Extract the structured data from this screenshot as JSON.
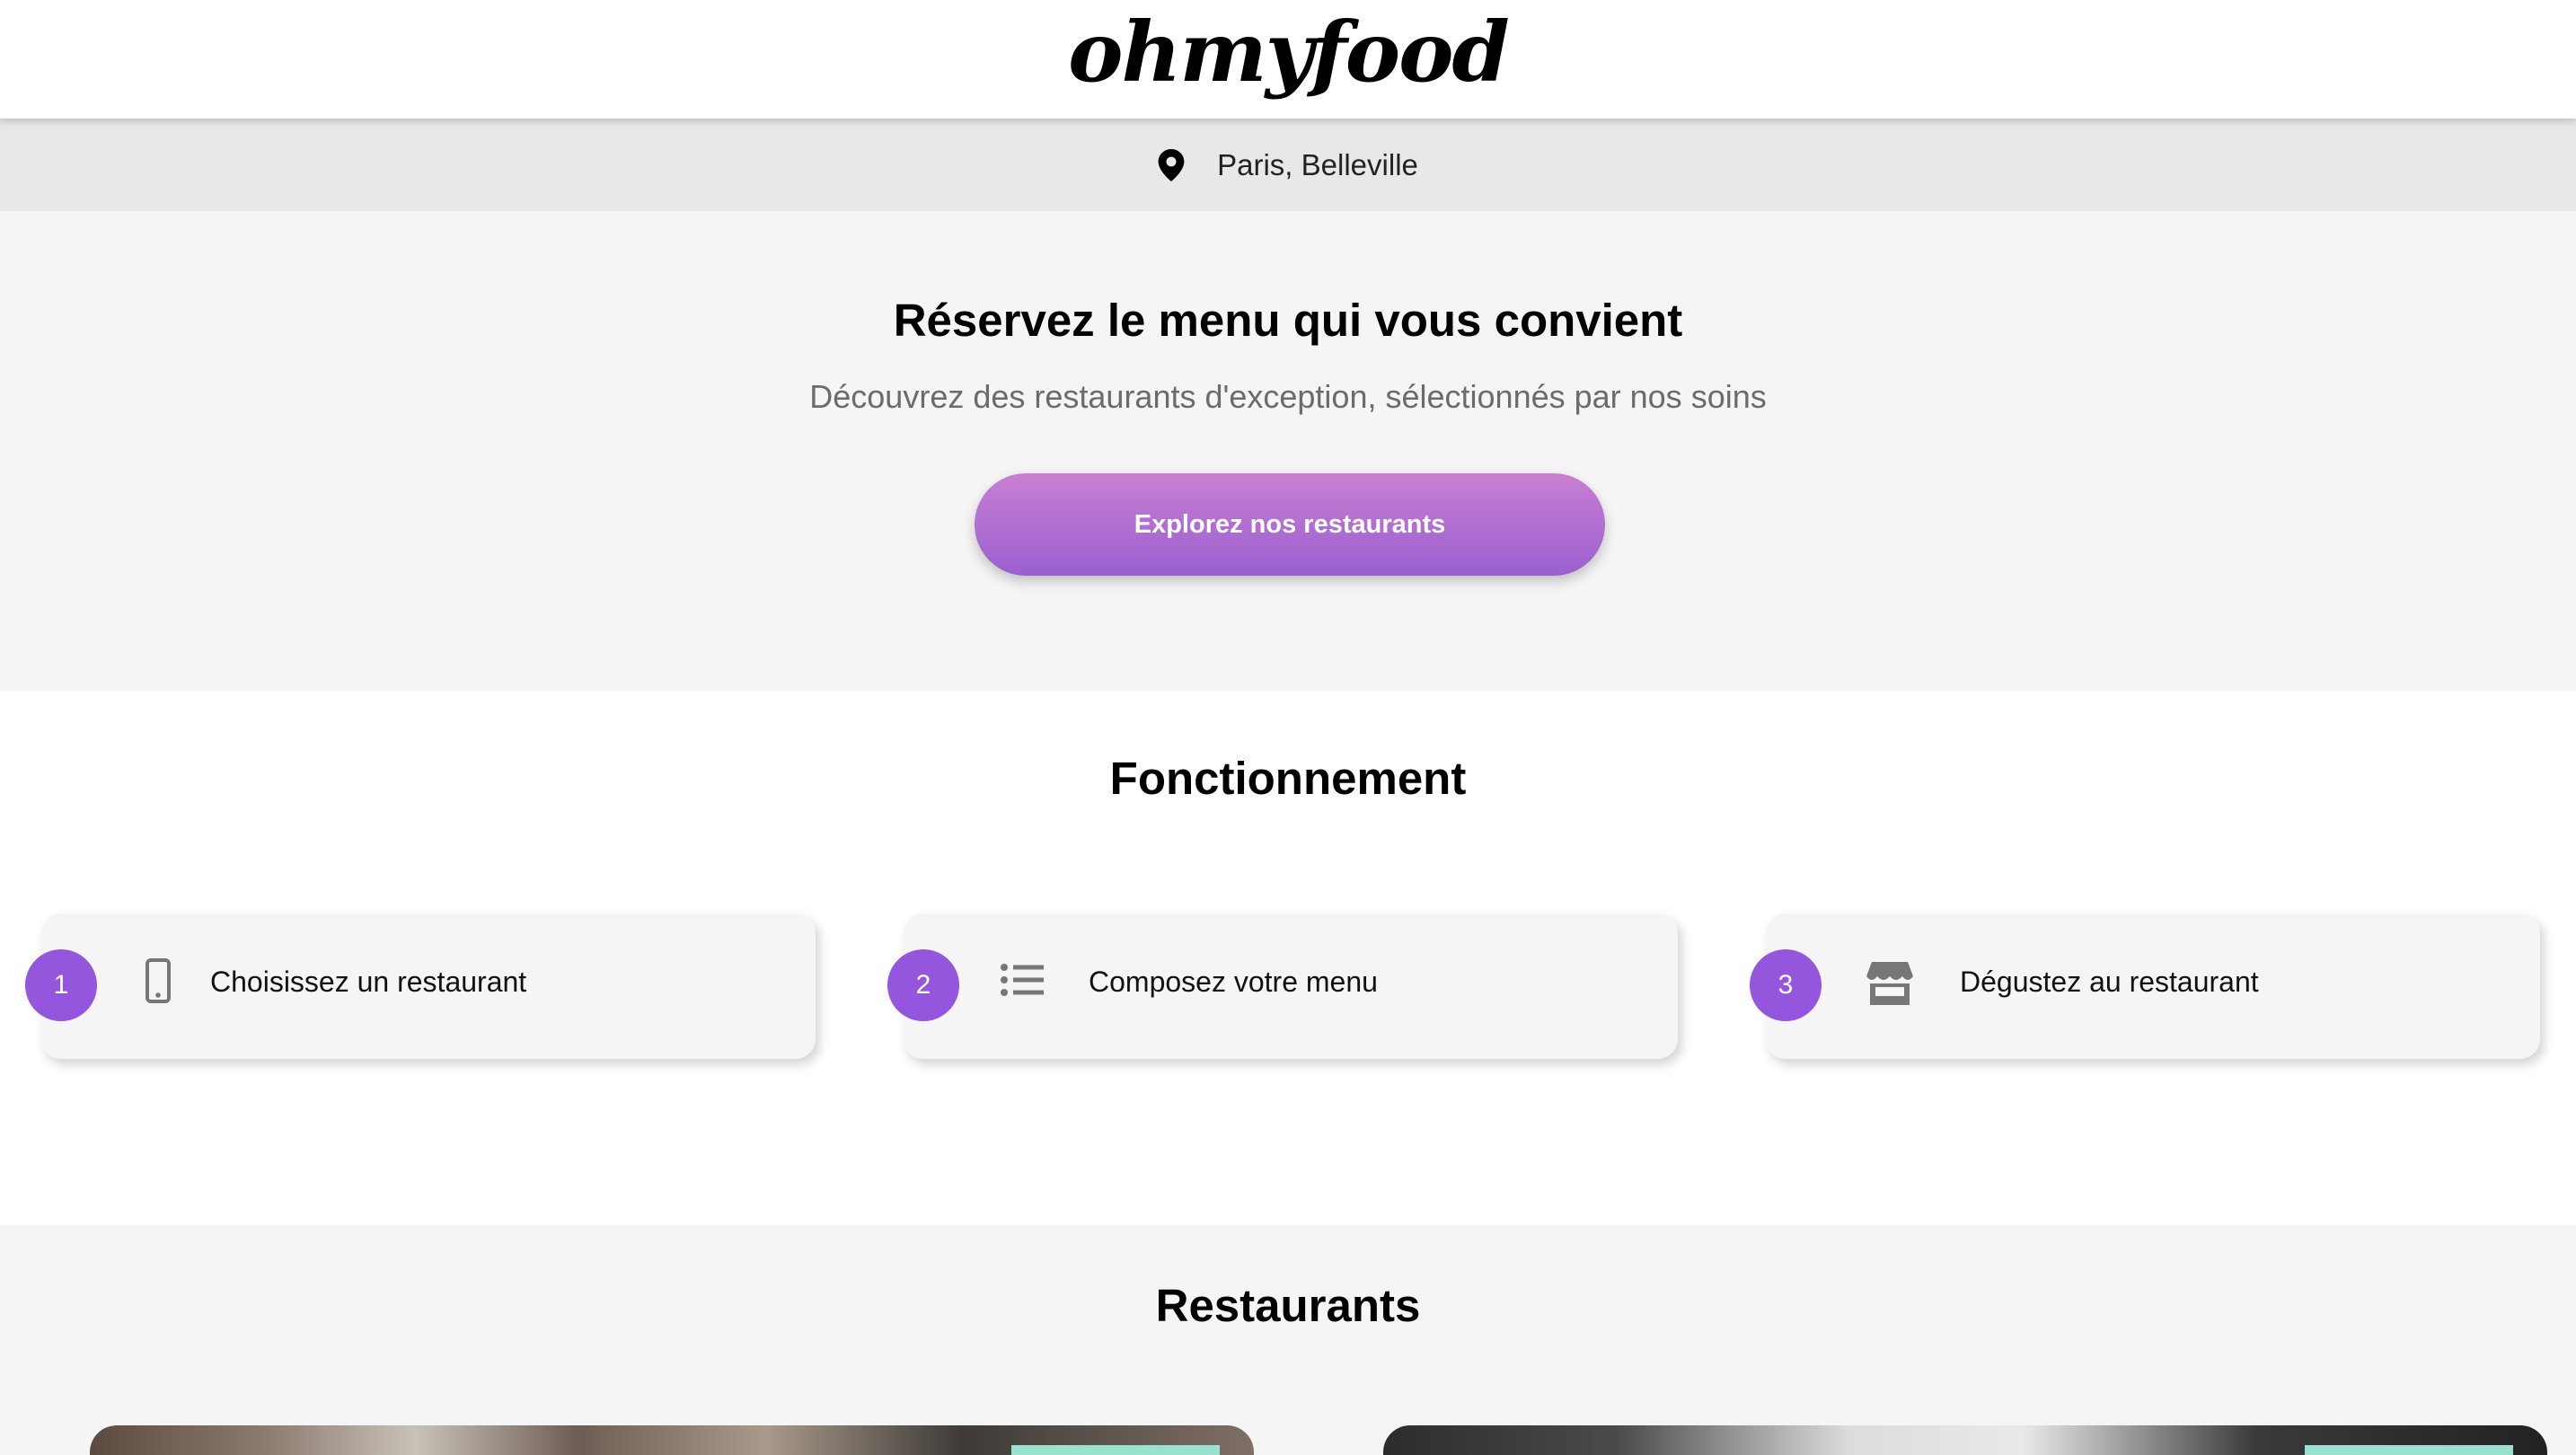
{
  "header": {
    "logo_text": "ohmyfood"
  },
  "location": {
    "icon": "map-pin-icon",
    "text": "Paris, Belleville"
  },
  "hero": {
    "title": "Réservez le menu qui vous convient",
    "subtitle": "Découvrez des restaurants d'exception, sélectionnés par nos soins",
    "button_label": "Explorez nos restaurants"
  },
  "how": {
    "title": "Fonctionnement",
    "steps": [
      {
        "number": "1",
        "icon": "phone-icon",
        "label": "Choisissez un restaurant"
      },
      {
        "number": "2",
        "icon": "list-icon",
        "label": "Composez votre menu"
      },
      {
        "number": "3",
        "icon": "store-icon",
        "label": "Dégustez au restaurant"
      }
    ]
  },
  "restaurants": {
    "title": "Restaurants"
  },
  "colors": {
    "accent_purple": "#9356dc",
    "button_gradient_top": "#c97fd2",
    "button_gradient_bottom": "#9a5fd0",
    "tag_mint": "#99e2d0"
  }
}
